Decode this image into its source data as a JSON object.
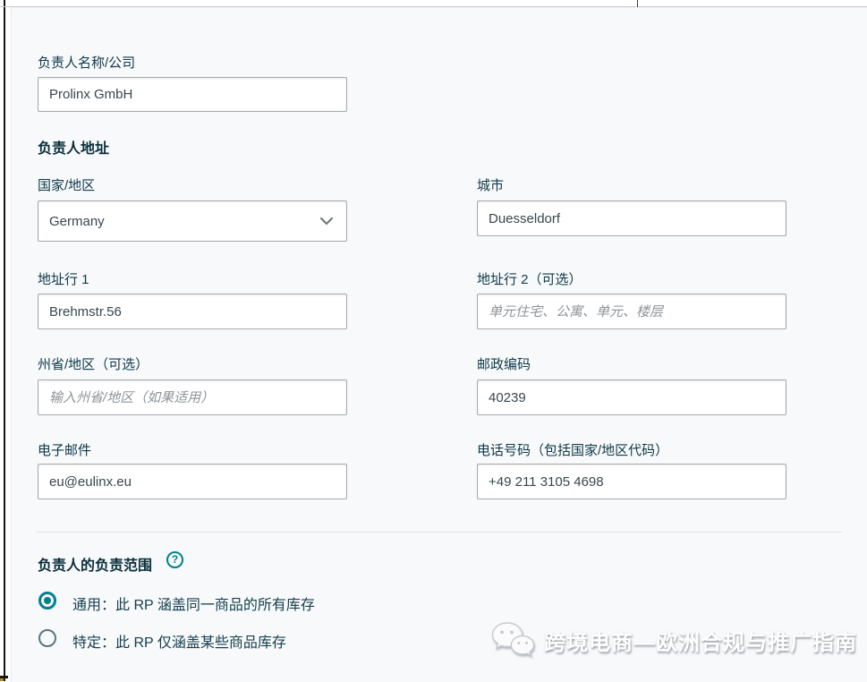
{
  "colors": {
    "accent_teal": "#00808e",
    "label_text": "#0e3a49",
    "input_border": "#a5a9ad",
    "panel_background": "#f8f9fb",
    "placeholder_text": "#8d9499"
  },
  "form": {
    "responsible_person_name": {
      "label": "负责人名称/公司",
      "value": "Prolinx GmbH"
    },
    "address_section_title": "负责人地址",
    "country": {
      "label": "国家/地区",
      "value": "Germany"
    },
    "city": {
      "label": "城市",
      "value": "Duesseldorf"
    },
    "address_line1": {
      "label": "地址行 1",
      "value": "Brehmstr.56"
    },
    "address_line2": {
      "label": "地址行 2（可选）",
      "placeholder": "单元住宅、公寓、单元、楼层"
    },
    "state": {
      "label": "州省/地区（可选）",
      "placeholder": "输入州省/地区（如果适用）"
    },
    "postal_code": {
      "label": "邮政编码",
      "value": "40239"
    },
    "email": {
      "label": "电子邮件",
      "value": "eu@eulinx.eu"
    },
    "phone": {
      "label": "电话号码（包括国家/地区代码）",
      "value": "+49 211 3105 4698"
    },
    "scope": {
      "title": "负责人的负责范围",
      "help_glyph": "?",
      "options": [
        {
          "label": "通用：此 RP 涵盖同一商品的所有库存",
          "selected": true
        },
        {
          "label": "特定：此 RP 仅涵盖某些商品库存",
          "selected": false
        }
      ]
    }
  },
  "watermark": {
    "icon": "wechat-icon",
    "text": "跨境电商—欧洲合规与推广指南"
  }
}
